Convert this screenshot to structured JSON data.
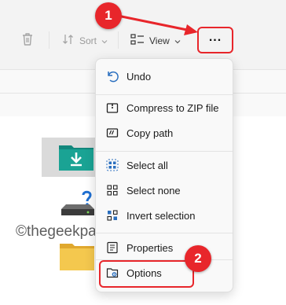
{
  "toolbar": {
    "delete_icon": "trash-icon",
    "sort_label": "Sort",
    "view_label": "View",
    "more_label": "..."
  },
  "menu": {
    "items": [
      {
        "label": "Undo",
        "icon": "undo-icon"
      },
      {
        "label": "Compress to ZIP file",
        "icon": "zip-icon"
      },
      {
        "label": "Copy path",
        "icon": "copy-path-icon"
      },
      {
        "label": "Select all",
        "icon": "select-all-icon"
      },
      {
        "label": "Select none",
        "icon": "select-none-icon"
      },
      {
        "label": "Invert selection",
        "icon": "invert-selection-icon"
      },
      {
        "label": "Properties",
        "icon": "properties-icon"
      },
      {
        "label": "Options",
        "icon": "options-icon"
      }
    ]
  },
  "annotations": {
    "step1": "1",
    "step2": "2",
    "watermark": "©thegeekpage.com"
  },
  "colors": {
    "accent_red": "#e8262b",
    "icon_blue": "#2a6fbf",
    "folder_teal": "#12877c",
    "folder_yellow": "#f4c84e"
  }
}
